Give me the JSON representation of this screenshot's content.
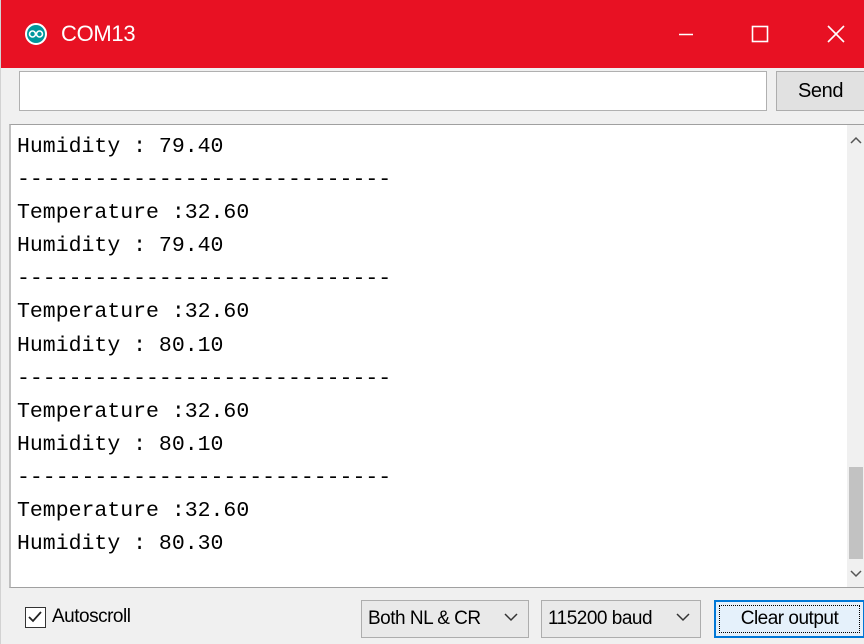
{
  "window": {
    "title": "COM13",
    "icon": "arduino-infinity-icon",
    "controls": [
      "minimize-icon",
      "maximize-icon",
      "close-icon"
    ],
    "accent_color": "#e81123"
  },
  "send_bar": {
    "input_value": "",
    "send_label": "Send"
  },
  "output": {
    "lines": [
      "Humidity : 79.40",
      "-----------------------------",
      "Temperature :32.60",
      "Humidity : 79.40",
      "-----------------------------",
      "Temperature :32.60",
      "Humidity : 80.10",
      "-----------------------------",
      "Temperature :32.60",
      "Humidity : 80.10",
      "-----------------------------",
      "Temperature :32.60",
      "Humidity : 80.30"
    ]
  },
  "bottom_bar": {
    "autoscroll_label": "Autoscroll",
    "autoscroll_checked": true,
    "line_ending": "Both NL & CR",
    "baud_rate": "115200 baud",
    "clear_label": "Clear output"
  }
}
